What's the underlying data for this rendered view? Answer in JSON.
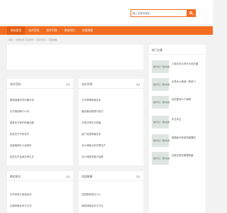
{
  "header": {
    "search_placeholder": "输入关键词搜索"
  },
  "nav": {
    "items": [
      "网站首页",
      "花卉百科",
      "花卉问答",
      "养花知识",
      "花园故事"
    ]
  },
  "breadcrumb": "首页 > 当前位置:花卉百科 > 花卉知识 > 花园故事",
  "cards": [
    {
      "title": "花卉百科",
      "more": "更多",
      "items": [
        "植物健康科学问题分析",
        "花卉植物种什么好",
        "春季花卉养护种植问题",
        "批发花卉市场花卉",
        "盆栽植物什么品种好",
        "批发花卉盆栽月季生长"
      ]
    },
    {
      "title": "花卉问答",
      "more": "更多",
      "items": [
        "日本草莓种植技术",
        "番茄栽培管理与知识",
        "月季月季花卉种植",
        "高产优质种植技术",
        "怎么种植出来好看花卉",
        "怎么种植苹果才结果"
      ]
    },
    {
      "title": "养花知识",
      "more": "更多",
      "items": [
        "花卉种类与栽培技术",
        "红薯种植技术与方法"
      ]
    },
    {
      "title": "花园故事",
      "more": "更多",
      "items": [
        "花园故事感动人心",
        "蔬菜种植技术与方法"
      ]
    }
  ],
  "hot": {
    "title": "热门文章",
    "thumb_label": "图片暂无一图片加载",
    "items": [
      "人参花怎么样什么地方最",
      "水芙木土栽培一般多少",
      "百花香怎么人家种",
      "半生半生",
      "葡萄秋天多种花都要好",
      "白菜汪菜花哪里种植"
    ]
  }
}
